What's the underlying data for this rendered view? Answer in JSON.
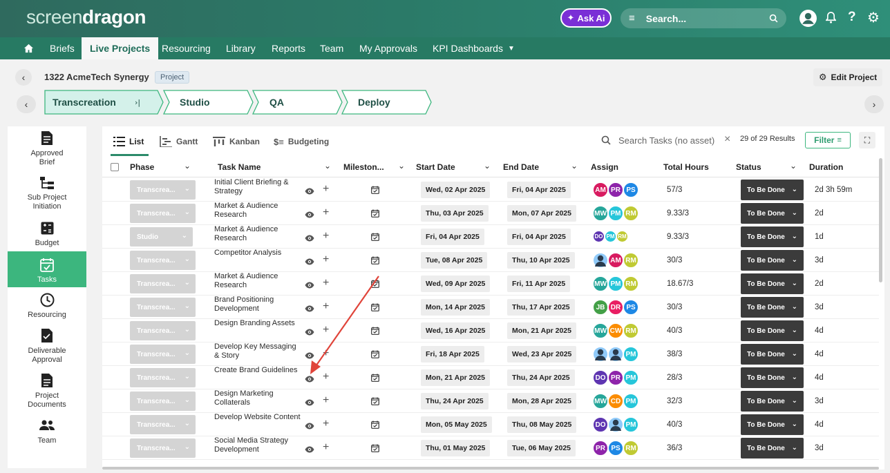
{
  "header": {
    "logo_part1": "screen",
    "logo_part2": "dragon",
    "ask_ai": "Ask Ai",
    "search_placeholder": "Search..."
  },
  "nav": {
    "items": [
      "Briefs",
      "Live Projects",
      "Resourcing",
      "Library",
      "Reports",
      "Team",
      "My Approvals",
      "KPI Dashboards"
    ],
    "active": "Live Projects"
  },
  "project": {
    "title": "1322 AcmeTech Synergy",
    "badge": "Project",
    "edit_label": "Edit Project"
  },
  "phases": [
    "Transcreation",
    "Studio",
    "QA",
    "Deploy"
  ],
  "sidebar": {
    "items": [
      {
        "label": "Approved Brief"
      },
      {
        "label": "Sub Project Initiation"
      },
      {
        "label": "Budget"
      },
      {
        "label": "Tasks"
      },
      {
        "label": "Resourcing"
      },
      {
        "label": "Deliverable Approval"
      },
      {
        "label": "Project Documents"
      },
      {
        "label": "Team"
      }
    ]
  },
  "views": {
    "tabs": [
      "List",
      "Gantt",
      "Kanban",
      "Budgeting"
    ],
    "active": "List",
    "search_placeholder": "Search Tasks (no asset)",
    "results": "29 of 29 Results",
    "filter_label": "Filter"
  },
  "table": {
    "columns": [
      "Phase",
      "Task Name",
      "Mileston...",
      "Start Date",
      "End Date",
      "Assign",
      "Total Hours",
      "Status",
      "Duration"
    ],
    "rows": [
      {
        "phase": "Transcrea...",
        "task": "Initial Client Briefing & Strategy",
        "start": "Wed, 02 Apr 2025",
        "end": "Fri, 04 Apr 2025",
        "assign": [
          "AM",
          "PR",
          "PS"
        ],
        "hours": "57/3",
        "status": "To Be Done",
        "duration": "2d 3h 59m"
      },
      {
        "phase": "Transcrea...",
        "task": "Market & Audience Research",
        "start": "Thu, 03 Apr 2025",
        "end": "Mon, 07 Apr 2025",
        "assign": [
          "MW",
          "PM",
          "RM"
        ],
        "hours": "9.33/3",
        "status": "To Be Done",
        "duration": "2d"
      },
      {
        "phase": "Studio",
        "task": "Market & Audience Research",
        "start": "Fri, 04 Apr 2025",
        "end": "Fri, 04 Apr 2025",
        "assign": [
          "DO",
          "PM",
          "RM"
        ],
        "hours": "9.33/3",
        "status": "To Be Done",
        "duration": "1d"
      },
      {
        "phase": "Transcrea...",
        "task": "Competitor Analysis",
        "start": "Tue, 08 Apr 2025",
        "end": "Thu, 10 Apr 2025",
        "assign": [
          "USER",
          "AM",
          "RM"
        ],
        "hours": "30/3",
        "status": "To Be Done",
        "duration": "3d"
      },
      {
        "phase": "Transcrea...",
        "task": "Market & Audience Research",
        "start": "Wed, 09 Apr 2025",
        "end": "Fri, 11 Apr 2025",
        "assign": [
          "MW",
          "PM",
          "RM"
        ],
        "hours": "18.67/3",
        "status": "To Be Done",
        "duration": "2d"
      },
      {
        "phase": "Transcrea...",
        "task": "Brand Positioning Development",
        "start": "Mon, 14 Apr 2025",
        "end": "Thu, 17 Apr 2025",
        "assign": [
          "JB",
          "DR",
          "PS"
        ],
        "hours": "30/3",
        "status": "To Be Done",
        "duration": "3d"
      },
      {
        "phase": "Transcrea...",
        "task": "Design Branding Assets",
        "start": "Wed, 16 Apr 2025",
        "end": "Mon, 21 Apr 2025",
        "assign": [
          "MW",
          "CW",
          "RM"
        ],
        "hours": "40/3",
        "status": "To Be Done",
        "duration": "4d"
      },
      {
        "phase": "Transcrea...",
        "task": "Develop Key Messaging & Story",
        "start": "Fri, 18 Apr 2025",
        "end": "Wed, 23 Apr 2025",
        "assign": [
          "USER",
          "USER",
          "PM"
        ],
        "hours": "38/3",
        "status": "To Be Done",
        "duration": "4d"
      },
      {
        "phase": "Transcrea...",
        "task": "Create Brand Guidelines",
        "start": "Mon, 21 Apr 2025",
        "end": "Thu, 24 Apr 2025",
        "assign": [
          "DO",
          "PR",
          "PM"
        ],
        "hours": "28/3",
        "status": "To Be Done",
        "duration": "4d"
      },
      {
        "phase": "Transcrea...",
        "task": "Design Marketing Collaterals",
        "start": "Thu, 24 Apr 2025",
        "end": "Mon, 28 Apr 2025",
        "assign": [
          "MW",
          "CD",
          "PM"
        ],
        "hours": "32/3",
        "status": "To Be Done",
        "duration": "3d"
      },
      {
        "phase": "Transcrea...",
        "task": "Develop Website Content",
        "start": "Mon, 05 May 2025",
        "end": "Thu, 08 May 2025",
        "assign": [
          "DO",
          "USER",
          "PM"
        ],
        "hours": "40/3",
        "status": "To Be Done",
        "duration": "4d"
      },
      {
        "phase": "Transcrea...",
        "task": "Social Media Strategy Development",
        "start": "Thu, 01 May 2025",
        "end": "Tue, 06 May 2025",
        "assign": [
          "PR",
          "PS",
          "RM"
        ],
        "hours": "36/3",
        "status": "To Be Done",
        "duration": "3d"
      }
    ]
  },
  "colors": {
    "brand": "#2b7a68",
    "active_green": "#3cb67e",
    "status_bg": "#3b3b3b",
    "annotation_arrow": "#e0443a",
    "avatar": {
      "AM": "#d81b60",
      "PR": "#8e24aa",
      "PS": "#1e88e5",
      "MW": "#26a69a",
      "PM": "#26c6da",
      "RM": "#c0ca33",
      "DO": "#5e35b1",
      "JB": "#43a047",
      "DR": "#e91e63",
      "CW": "#fb8c00",
      "CD": "#fb8c00",
      "USER": "#90caf9"
    }
  }
}
